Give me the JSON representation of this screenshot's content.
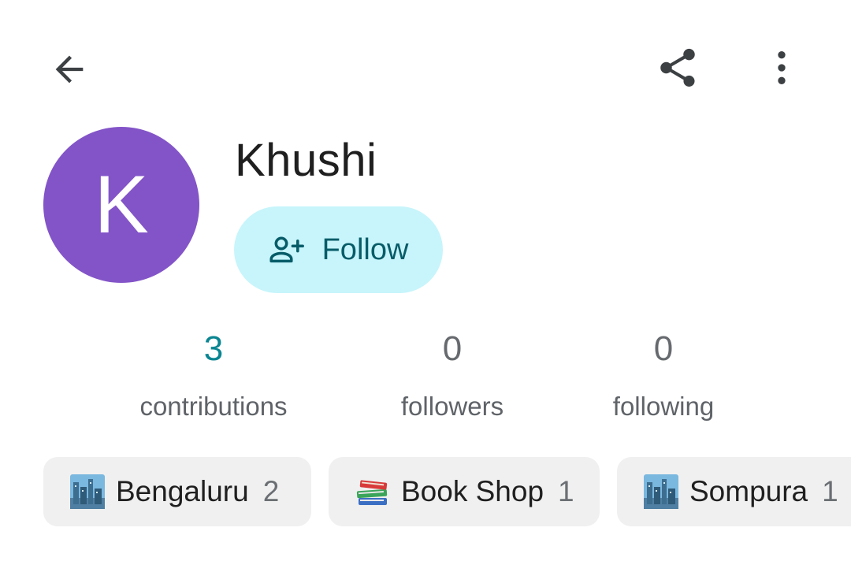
{
  "toolbar": {
    "back_icon": "arrow-back-icon",
    "share_icon": "share-icon",
    "more_icon": "more-vert-icon"
  },
  "profile": {
    "avatar_letter": "K",
    "avatar_color": "#8354c8",
    "name": "Khushi",
    "follow_label": "Follow",
    "follow_icon": "person-add-icon",
    "follow_bg": "#c7f5fb"
  },
  "stats": [
    {
      "value": "3",
      "label": "contributions"
    },
    {
      "value": "0",
      "label": "followers"
    },
    {
      "value": "0",
      "label": "following"
    }
  ],
  "chips": [
    {
      "icon": "cityscape-icon",
      "label": "Bengaluru",
      "count": "2"
    },
    {
      "icon": "books-icon",
      "label": "Book Shop",
      "count": "1"
    },
    {
      "icon": "cityscape-icon",
      "label": "Sompura",
      "count": "1"
    }
  ]
}
